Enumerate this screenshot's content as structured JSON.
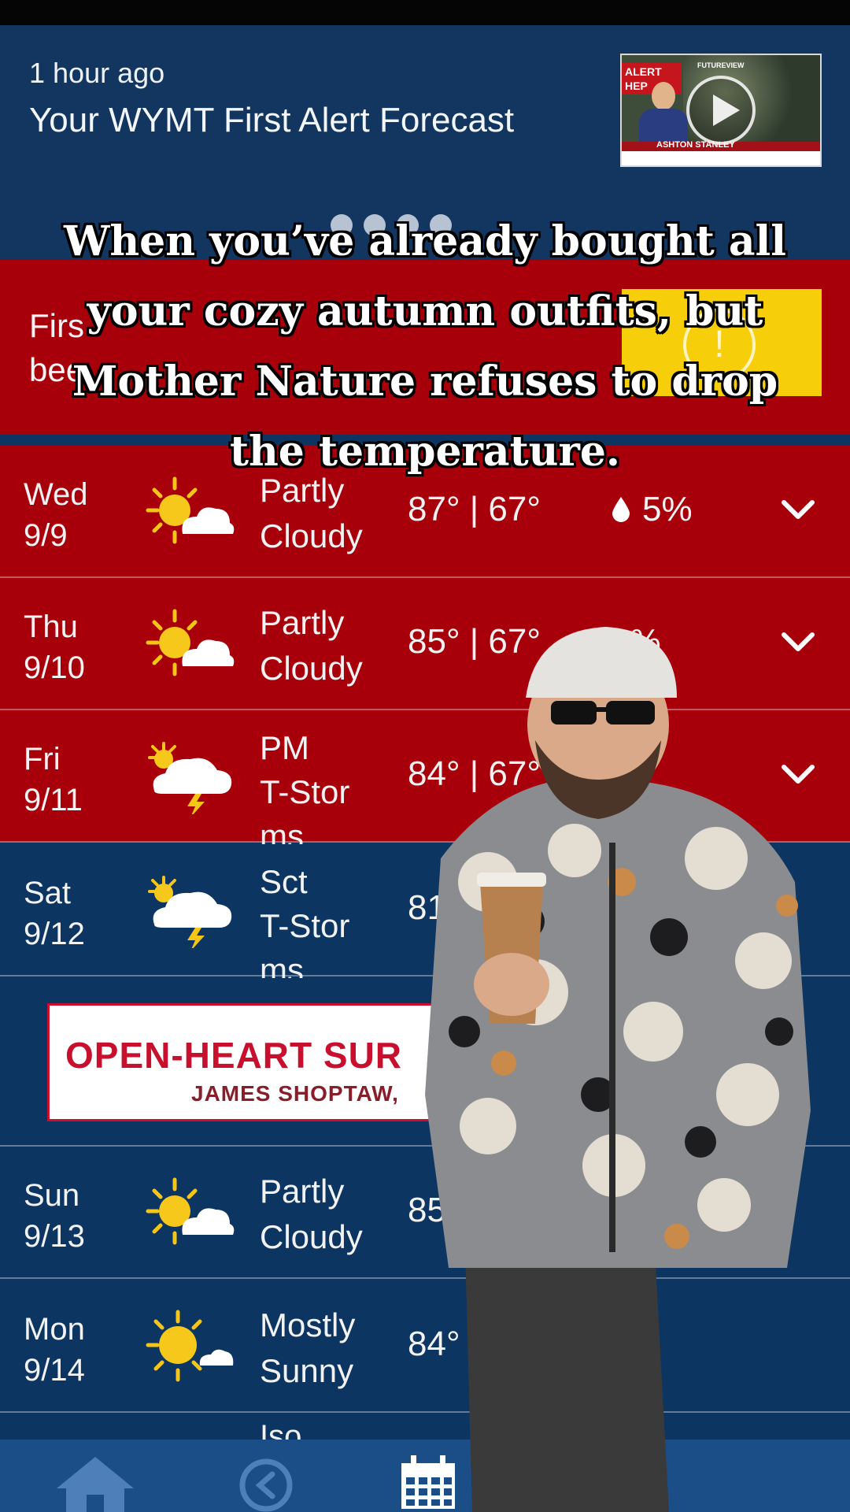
{
  "video": {
    "time": "1 hour ago",
    "title": "Your WYMT First Alert Forecast",
    "thumb_alert_tag": "ALERT HEP",
    "thumb_futureview": "FUTUREVIEW",
    "thumb_anchor_name": "ASHTON STANLEY",
    "play_icon": "play-icon"
  },
  "carousel": {
    "count": 4
  },
  "alert": {
    "text_visible": "Firs           have\nbee",
    "icon": "alert-icon"
  },
  "caption": {
    "text": "When you’ve already bought all your cozy autumn outfits, but Mother Nature refuses to drop the temperature."
  },
  "forecast": [
    {
      "day": "Wed",
      "date": "9/9",
      "icon": "partly-cloudy-icon",
      "cond_1": "Partly",
      "cond_2": "Cloudy",
      "cond_3": "",
      "temps": "87° | 67°",
      "precip": "5%",
      "color": "#a8000a"
    },
    {
      "day": "Thu",
      "date": "9/10",
      "icon": "partly-cloudy-icon",
      "cond_1": "Partly",
      "cond_2": "Cloudy",
      "cond_3": "",
      "temps": "85° | 67°",
      "precip": "0%",
      "color": "#a8000a"
    },
    {
      "day": "Fri",
      "date": "9/11",
      "icon": "thunderstorm-icon",
      "cond_1": "PM",
      "cond_2": "T-Stor",
      "cond_3": "ms",
      "temps": "84° | 67°",
      "precip": "%",
      "color": "#a8000a"
    },
    {
      "day": "Sat",
      "date": "9/12",
      "icon": "thunderstorm-icon",
      "cond_1": "Sct",
      "cond_2": "T-Stor",
      "cond_3": "ms",
      "temps": "81",
      "precip": "",
      "color": "#0d3561"
    },
    {
      "day": "Sun",
      "date": "9/13",
      "icon": "partly-cloudy-icon",
      "cond_1": "Partly",
      "cond_2": "Cloudy",
      "cond_3": "",
      "temps": "85°",
      "precip": "",
      "color": "#0d3561"
    },
    {
      "day": "Mon",
      "date": "9/14",
      "icon": "mostly-sunny-icon",
      "cond_1": "Mostly",
      "cond_2": "Sunny",
      "cond_3": "",
      "temps": "84°",
      "precip": "",
      "color": "#0d3561"
    }
  ],
  "ad": {
    "line1": "OPEN-HEART SUR",
    "line2": "JAMES SHOPTAW, "
  },
  "partial_row": {
    "cond": "Iso"
  },
  "nav": [
    {
      "label": "home",
      "icon": "home-icon"
    },
    {
      "label": "clock",
      "icon": "clock-icon"
    },
    {
      "label": "calendar",
      "icon": "calendar-icon"
    }
  ],
  "colors": {
    "alert_red": "#a8000a",
    "app_navy": "#0d3561",
    "alert_yellow": "#f7ce0a"
  }
}
